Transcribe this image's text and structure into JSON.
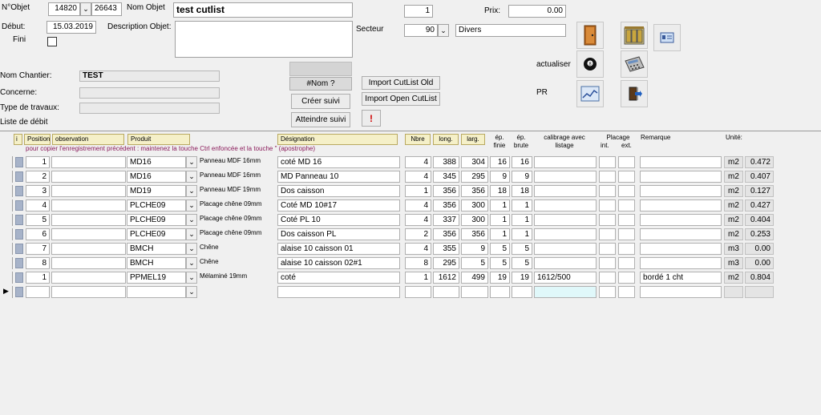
{
  "header": {
    "nobjet_label": "N°Objet",
    "nobjet_value": "14820",
    "nobjet_second": "26643",
    "nom_objet_label": "Nom Objet",
    "nom_objet_value": "test cutlist",
    "debut_label": "Début:",
    "debut_value": "15.03.2019",
    "fini_label": "Fini",
    "description_label": "Description Objet:",
    "description_value": "",
    "top_number": "1",
    "prix_label": "Prix:",
    "prix_value": "0.00",
    "secteur_label": "Secteur",
    "secteur_value": "90",
    "secteur_text": "Divers",
    "actualiser_label": "actualiser",
    "pr_label": "PR",
    "nom_chantier_label": "Nom Chantier:",
    "nom_chantier_value": "TEST",
    "concerne_label": "Concerne:",
    "type_travaux_label": "Type de travaux:",
    "liste_debit_label": "Liste de débit"
  },
  "buttons": {
    "nom_btn": "#Nom ?",
    "creer_suivi": "Créer suivi",
    "atteindre_suivi": "Atteindre suivi",
    "warn": "!",
    "import_old": "Import CutList Old",
    "import_open": "Import Open CutList"
  },
  "table": {
    "headers": {
      "i": "i",
      "position": "Position",
      "observation": "observation",
      "produit": "Produit",
      "designation": "Désignation",
      "nbre": "Nbre",
      "long": "long.",
      "larg": "larg.",
      "ep_finie": "ép. finie",
      "ep_brute": "ép. brute",
      "calibrage": "calibrage avec listage",
      "placage": "Placage",
      "placage_int": "int.",
      "placage_ext": "ext.",
      "remarque": "Remarque",
      "unite": "Unité:"
    },
    "hint": "pour copier l'enregistrement précédent : maintenez la touche Ctrl enfoncée et la touche \" (apostrophe)",
    "rows": [
      {
        "pos": "1",
        "obs": "",
        "produit": "MD16",
        "pdesc": "Panneau MDF 16mm",
        "design": "coté MD 16",
        "nbre": "4",
        "long": "388",
        "larg": "304",
        "epf": "16",
        "epb": "16",
        "calib": "",
        "rem": "",
        "unit": "m2",
        "val": "0.472"
      },
      {
        "pos": "2",
        "obs": "",
        "produit": "MD16",
        "pdesc": "Panneau MDF 16mm",
        "design": "MD Panneau 10",
        "nbre": "4",
        "long": "345",
        "larg": "295",
        "epf": "9",
        "epb": "9",
        "calib": "",
        "rem": "",
        "unit": "m2",
        "val": "0.407"
      },
      {
        "pos": "3",
        "obs": "",
        "produit": "MD19",
        "pdesc": "Panneau MDF 19mm",
        "design": "Dos caisson",
        "nbre": "1",
        "long": "356",
        "larg": "356",
        "epf": "18",
        "epb": "18",
        "calib": "",
        "rem": "",
        "unit": "m2",
        "val": "0.127"
      },
      {
        "pos": "4",
        "obs": "",
        "produit": "PLCHE09",
        "pdesc": "Placage chêne 09mm",
        "design": "Coté MD 10#17",
        "nbre": "4",
        "long": "356",
        "larg": "300",
        "epf": "1",
        "epb": "1",
        "calib": "",
        "rem": "",
        "unit": "m2",
        "val": "0.427"
      },
      {
        "pos": "5",
        "obs": "",
        "produit": "PLCHE09",
        "pdesc": "Placage chêne 09mm",
        "design": "Coté PL 10",
        "nbre": "4",
        "long": "337",
        "larg": "300",
        "epf": "1",
        "epb": "1",
        "calib": "",
        "rem": "",
        "unit": "m2",
        "val": "0.404"
      },
      {
        "pos": "6",
        "obs": "",
        "produit": "PLCHE09",
        "pdesc": "Placage chêne 09mm",
        "design": "Dos caisson PL",
        "nbre": "2",
        "long": "356",
        "larg": "356",
        "epf": "1",
        "epb": "1",
        "calib": "",
        "rem": "",
        "unit": "m2",
        "val": "0.253"
      },
      {
        "pos": "7",
        "obs": "",
        "produit": "BMCH",
        "pdesc": "Chêne",
        "design": "alaise 10 caisson 01",
        "nbre": "4",
        "long": "355",
        "larg": "9",
        "epf": "5",
        "epb": "5",
        "calib": "",
        "rem": "",
        "unit": "m3",
        "val": "0.00"
      },
      {
        "pos": "8",
        "obs": "",
        "produit": "BMCH",
        "pdesc": "Chêne",
        "design": "alaise 10 caisson 02#1",
        "nbre": "8",
        "long": "295",
        "larg": "5",
        "epf": "5",
        "epb": "5",
        "calib": "",
        "rem": "",
        "unit": "m3",
        "val": "0.00"
      },
      {
        "pos": "1",
        "obs": "",
        "produit": "PPMEL19",
        "pdesc": "Mélaminé 19mm",
        "design": "coté",
        "nbre": "1",
        "long": "1612",
        "larg": "499",
        "epf": "19",
        "epb": "19",
        "calib": "1612/500",
        "rem": "bordé 1 cht",
        "unit": "m2",
        "val": "0.804"
      }
    ],
    "new_row_marker": "▶"
  }
}
